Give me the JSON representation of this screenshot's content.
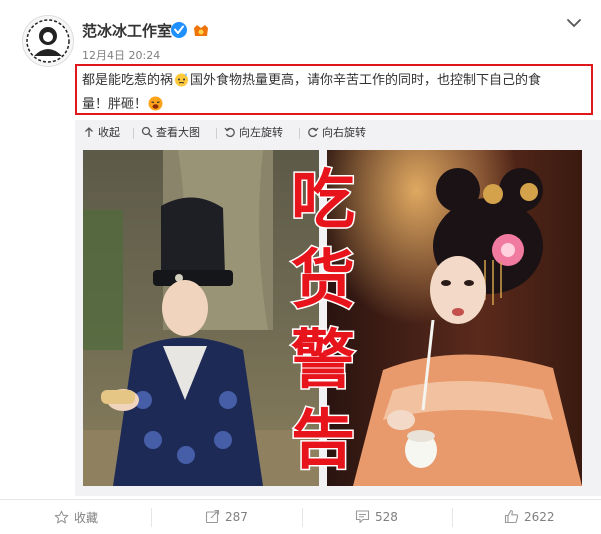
{
  "author": {
    "name": "范冰冰工作室",
    "timestamp": "12月4日 20:24"
  },
  "post": {
    "text_part1": "都是能吃惹的祸",
    "text_part2": "国外食物热量更高，请你辛苦工作的同时，也控制下自己的食",
    "text_part3": "量！胖砸！"
  },
  "image_toolbar": {
    "collapse": "收起",
    "view_large": "查看大图",
    "rotate_left": "向左旋转",
    "rotate_right": "向右旋转"
  },
  "image": {
    "overlay_chars": [
      "吃",
      "货",
      "警",
      "告"
    ]
  },
  "actions": {
    "favorite": "收藏",
    "repost_count": "287",
    "comment_count": "528",
    "like_count": "2622"
  },
  "colors": {
    "highlight_border": "#e0181c",
    "verified_blue": "#1e90ff",
    "overlay_red": "#e8141c"
  }
}
